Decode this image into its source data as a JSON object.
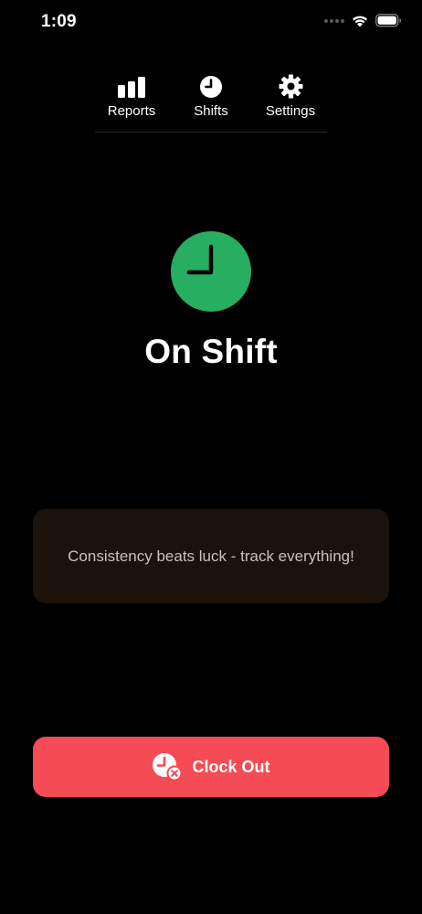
{
  "status_bar": {
    "time": "1:09",
    "icons": [
      "cellular-dots-icon",
      "wifi-icon",
      "battery-icon"
    ]
  },
  "nav": {
    "items": [
      {
        "label": "Reports",
        "icon": "bar-chart-icon"
      },
      {
        "label": "Shifts",
        "icon": "clock-icon"
      },
      {
        "label": "Settings",
        "icon": "gear-icon"
      }
    ]
  },
  "status": {
    "title": "On Shift",
    "icon": "clock-icon",
    "icon_color": "#27ae60"
  },
  "quote": {
    "text": "Consistency beats luck - track everything!"
  },
  "actions": {
    "clock_out_label": "Clock Out",
    "clock_out_icon": "clock-cancel-icon",
    "clock_out_color": "#f44b55"
  }
}
